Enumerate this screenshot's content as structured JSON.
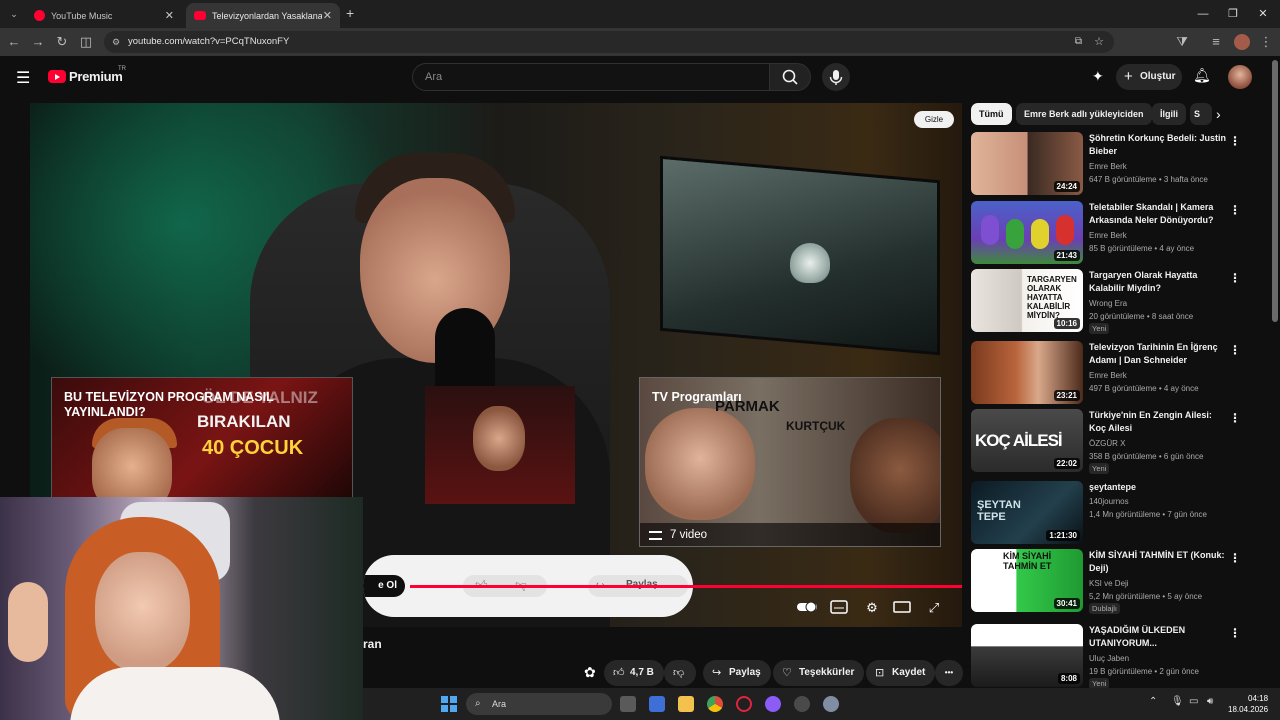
{
  "browser": {
    "tabs": [
      {
        "title": "YouTube Music",
        "active": false
      },
      {
        "title": "Televizyonlardan Yasaklanan Gü",
        "active": true
      }
    ],
    "new_tab": "+",
    "url": "youtube.com/watch?v=PCqTNuxonFY"
  },
  "header": {
    "logo_text": "Premium",
    "logo_sup": "TR",
    "search_placeholder": "Ara",
    "create_label": "Oluştur"
  },
  "player": {
    "hide_button": "Gizle",
    "card_left": {
      "line1": "BU TELEVİZYON PROGRAM NASIL YAYINLANDI?",
      "big1": "BIRAKILAN",
      "big2": "40 ÇOCUK",
      "ghost": "ÖL DE YALNIZ"
    },
    "card_right": {
      "title": "TV Programları",
      "overlay1": "PARMAK",
      "overlay2": "KURTÇUK",
      "playlist": "7 video"
    },
    "pill_subscribe": "e Ol",
    "pill_share": "Paylaş",
    "progress_fraction": 1.0
  },
  "below_video": {
    "title_partial": "ran",
    "likes": "4,7 B",
    "share": "Paylaş",
    "thanks": "Teşekkürler",
    "save": "Kaydet",
    "more": "•••"
  },
  "sidebar": {
    "chips": [
      "Tümü",
      "Emre Berk adlı yükleyiciden",
      "İlgili",
      "S"
    ],
    "items": [
      {
        "title": "Şöhretin Korkunç Bedeli: Justin Bieber",
        "channel": "Emre Berk",
        "meta": "647 B görüntüleme • 3 hafta önce",
        "duration": "24:24",
        "badge": ""
      },
      {
        "title": "Teletabiler Skandalı | Kamera Arkasında Neler Dönüyordu?",
        "channel": "Emre Berk",
        "meta": "85 B görüntüleme • 4 ay önce",
        "duration": "21:43",
        "badge": ""
      },
      {
        "title": "Targaryen Olarak Hayatta Kalabilir Miydin?",
        "channel": "Wrong Era",
        "meta": "20 görüntüleme • 8 saat önce",
        "duration": "10:16",
        "badge": "Yeni"
      },
      {
        "title": "Televizyon Tarihinin En İğrenç Adamı | Dan Schneider",
        "channel": "Emre Berk",
        "meta": "497 B görüntüleme • 4 ay önce",
        "duration": "23:21",
        "badge": ""
      },
      {
        "title": "Türkiye'nin En Zengin Ailesi: Koç Ailesi",
        "channel": "ÖZGÜR X",
        "meta": "358 B görüntüleme • 6 gün önce",
        "duration": "22:02",
        "badge": "Yeni"
      },
      {
        "title": "şeytantepe",
        "channel": "140journos",
        "meta": "1,4 Mn görüntüleme • 7 gün önce",
        "duration": "1:21:30",
        "badge": ""
      },
      {
        "title": "KİM SİYAHİ TAHMİN ET (Konuk: Deji)",
        "channel": "KSI ve Deji",
        "meta": "5,2 Mn görüntüleme • 5 ay önce",
        "duration": "30:41",
        "badge": "Dublajlı"
      },
      {
        "title": "YAŞADIĞIM ÜLKEDEN UTANIYORUM...",
        "channel": "Uluç Jaben",
        "meta": "19 B görüntüleme • 2 gün önce",
        "duration": "8:08",
        "badge": "Yeni"
      }
    ],
    "thumb_texts": {
      "targaryen": "TARGARYEN OLARAK HAYATTA KALABİLİR MİYDİN?",
      "koc": "KOÇ AİLESİ",
      "seytan": "ŞEYTAN TEPE",
      "kim": "KİM SİYAHİ TAHMİN ET"
    }
  },
  "taskbar": {
    "search": "Ara",
    "time": "04:18",
    "date": "18.04.2026"
  },
  "colors": {
    "accent": "#ff0033",
    "background": "#0f0f0f",
    "chip": "#272727"
  }
}
